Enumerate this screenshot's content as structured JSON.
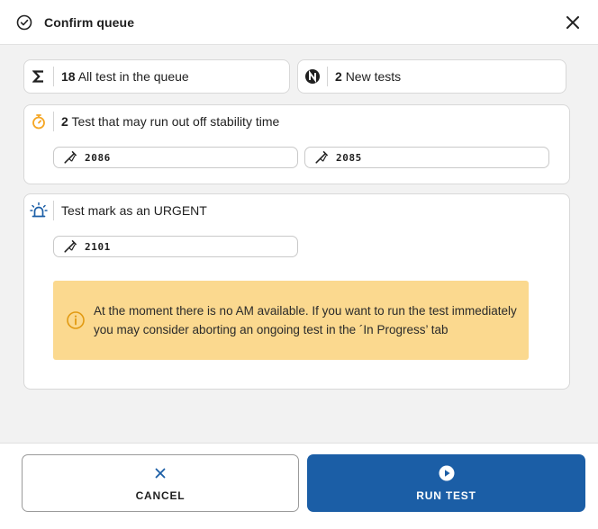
{
  "dialog": {
    "title": "Confirm queue",
    "close_icon": "close-icon",
    "title_icon": "check-circle-icon"
  },
  "summary": {
    "all_tests": {
      "count": "18",
      "label": "All test in the queue",
      "icon": "sigma-icon"
    },
    "new_tests": {
      "count": "2",
      "label": "New tests",
      "icon": "new-badge-icon"
    }
  },
  "stability": {
    "count": "2",
    "label": "Test that may run out off stability time",
    "icon": "stopwatch-icon",
    "accent": "#f5a623",
    "items": [
      "2086",
      "2085"
    ]
  },
  "urgent": {
    "label": "Test mark as an URGENT",
    "icon": "siren-icon",
    "accent": "#1b5ea6",
    "items": [
      "2101"
    ],
    "warning": {
      "icon": "info-icon",
      "text": "At the moment there is no AM available. If you want to run the test immediately you may consider aborting an ongoing test in the ´In Progress’ tab",
      "color": "#fbd98f"
    }
  },
  "actions": {
    "cancel_label": "CANCEL",
    "run_label": "RUN TEST",
    "run_color": "#1b5ea6"
  }
}
